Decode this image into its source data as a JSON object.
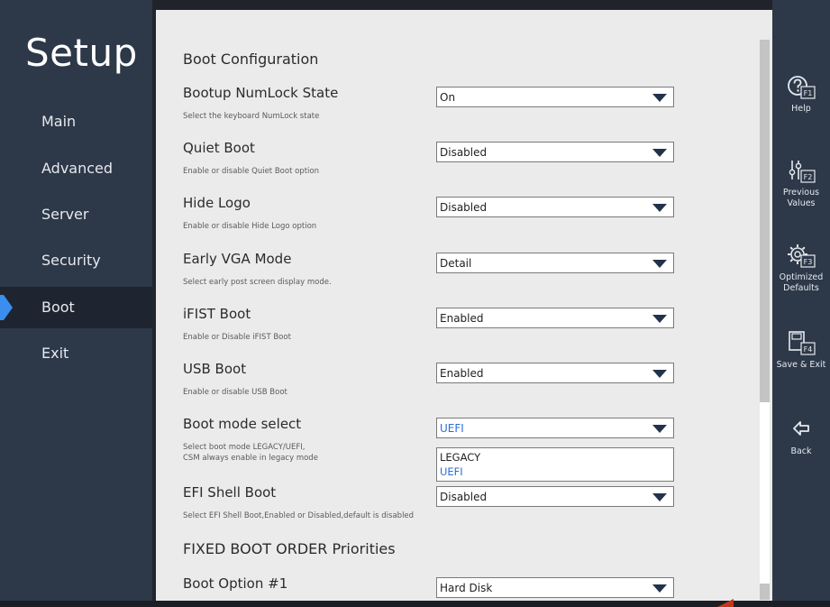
{
  "app": {
    "title": "Setup"
  },
  "nav": {
    "items": [
      {
        "label": "Main"
      },
      {
        "label": "Advanced"
      },
      {
        "label": "Server"
      },
      {
        "label": "Security"
      },
      {
        "label": "Boot"
      },
      {
        "label": "Exit"
      }
    ],
    "active": "Boot"
  },
  "main": {
    "section_title": "Boot Configuration",
    "options": [
      {
        "label": "Bootup NumLock State",
        "desc": "Select the keyboard NumLock state",
        "value": "On"
      },
      {
        "label": "Quiet Boot",
        "desc": "Enable or disable Quiet Boot option",
        "value": "Disabled"
      },
      {
        "label": "Hide Logo",
        "desc": "Enable or disable Hide Logo option",
        "value": "Disabled"
      },
      {
        "label": "Early VGA Mode",
        "desc": "Select early post screen display mode.",
        "value": "Detail"
      },
      {
        "label": "iFIST Boot",
        "desc": "Enable or Disable iFIST Boot",
        "value": "Enabled"
      },
      {
        "label": "USB Boot",
        "desc": "Enable or disable USB Boot",
        "value": "Enabled"
      },
      {
        "label": "Boot mode select",
        "desc": "Select boot mode LEGACY/UEFI,\nCSM always enable in legacy mode",
        "value": "UEFI",
        "dropdown_options": [
          "LEGACY",
          "UEFI"
        ]
      },
      {
        "label": "EFI Shell Boot",
        "desc": "Select EFI Shell Boot,Enabled or Disabled,default is disabled",
        "value": "Disabled"
      }
    ],
    "section2_title": "FIXED BOOT ORDER Priorities",
    "boot_option": {
      "label": "Boot Option #1",
      "value": "Hard Disk"
    }
  },
  "functions": [
    {
      "label": "Help",
      "key": "F1",
      "icon": "help-icon"
    },
    {
      "label": "Previous\nValues",
      "key": "F2",
      "icon": "sliders-icon"
    },
    {
      "label": "Optimized\nDefaults",
      "key": "F3",
      "icon": "gear-icon"
    },
    {
      "label": "Save & Exit",
      "key": "F4",
      "icon": "save-icon"
    },
    {
      "label": "Back",
      "key": "",
      "icon": "back-arrow-icon"
    }
  ],
  "colors": {
    "nav_bg": "#2d3849",
    "panel_bg": "#ecebec",
    "accent": "#3a8ef0",
    "selected_text": "#2a6fd6"
  }
}
